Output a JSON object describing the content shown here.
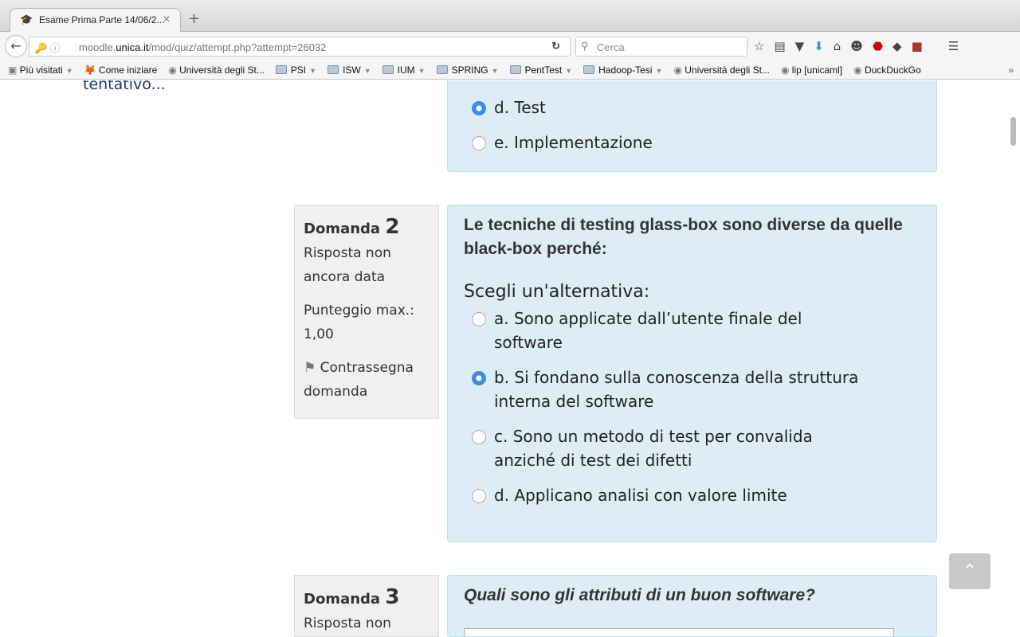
{
  "browser": {
    "tab_title": "Esame Prima Parte 14/06/2...",
    "url_prefix": "moodle.",
    "url_domain": "unica.it",
    "url_path": "/mod/quiz/attempt.php?attempt=26032",
    "search_placeholder": "Cerca"
  },
  "bookmarks": [
    {
      "label": "Più visitati",
      "type": "smart",
      "dropdown": true
    },
    {
      "label": "Come iniziare",
      "type": "firefox"
    },
    {
      "label": "Università degli St...",
      "type": "site"
    },
    {
      "label": "PSI",
      "type": "folder",
      "dropdown": true
    },
    {
      "label": "ISW",
      "type": "folder",
      "dropdown": true
    },
    {
      "label": "IUM",
      "type": "folder",
      "dropdown": true
    },
    {
      "label": "SPRING",
      "type": "folder",
      "dropdown": true
    },
    {
      "label": "PentTest",
      "type": "folder",
      "dropdown": true
    },
    {
      "label": "Hadoop-Tesi",
      "type": "folder",
      "dropdown": true
    },
    {
      "label": "Università degli St...",
      "type": "site"
    },
    {
      "label": "lip [unicaml]",
      "type": "site"
    },
    {
      "label": "DuckDuckGo",
      "type": "site"
    }
  ],
  "page": {
    "prev_text": "tentativo...",
    "q1_options": [
      {
        "label": "d. Test",
        "selected": true
      },
      {
        "label": "e. Implementazione",
        "selected": false
      }
    ],
    "q2": {
      "label": "Domanda",
      "number": "2",
      "status": "Risposta non ancora data",
      "max_score": "Punteggio max.: 1,00",
      "flag": "Contrassegna domanda",
      "text": "Le tecniche di testing glass-box sono diverse da quelle black-box perché:",
      "prompt": "Scegli un'alternativa:",
      "options": [
        {
          "label": "a. Sono applicate dall’utente finale del software",
          "selected": false
        },
        {
          "label": "b. Si fondano sulla conoscenza della struttura interna del software",
          "selected": true
        },
        {
          "label": "c. Sono un metodo di test per convalida anziché di test dei difetti",
          "selected": false
        },
        {
          "label": "d. Applicano analisi con valore limite",
          "selected": false
        }
      ]
    },
    "q3": {
      "label": "Domanda",
      "number": "3",
      "status": "Risposta non",
      "text": "Quali sono gli attributi di un buon software?"
    }
  }
}
